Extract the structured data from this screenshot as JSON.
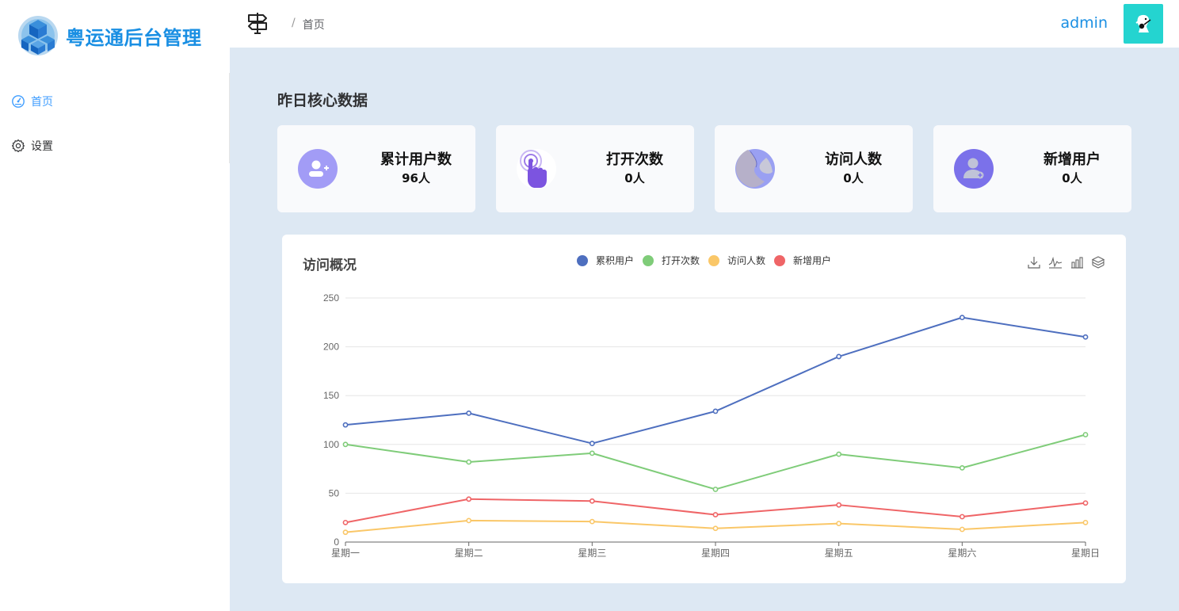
{
  "brand": {
    "title": "粤运通后台管理"
  },
  "sidebar": {
    "items": [
      {
        "label": "首页",
        "icon": "dashboard-icon",
        "active": true
      },
      {
        "label": "设置",
        "icon": "gear-icon",
        "active": false
      }
    ]
  },
  "header": {
    "breadcrumb": {
      "separator": "/",
      "current": "首页"
    },
    "username": "admin"
  },
  "main": {
    "section_title": "昨日核心数据",
    "stats": [
      {
        "label": "累计用户数",
        "value": "96人",
        "icon": "add-user-icon"
      },
      {
        "label": "打开次数",
        "value": "0人",
        "icon": "tap-hand-icon"
      },
      {
        "label": "访问人数",
        "value": "0人",
        "icon": "visitors-icon"
      },
      {
        "label": "新增用户",
        "value": "0人",
        "icon": "new-user-icon"
      }
    ],
    "chart_title": "访问概况"
  },
  "colors": {
    "accent": "#409eff",
    "brand": "#1a8fe3",
    "background": "#dde8f3",
    "avatar_bg": "#24d4d0"
  },
  "chart_data": {
    "type": "line",
    "categories": [
      "星期一",
      "星期二",
      "星期三",
      "星期四",
      "星期五",
      "星期六",
      "星期日"
    ],
    "series": [
      {
        "name": "累积用户",
        "color": "#4e6fbf",
        "values": [
          120,
          132,
          101,
          134,
          190,
          230,
          210
        ]
      },
      {
        "name": "打开次数",
        "color": "#7fcc79",
        "values": [
          100,
          82,
          91,
          54,
          90,
          76,
          110
        ]
      },
      {
        "name": "访问人数",
        "color": "#fac768",
        "values": [
          10,
          22,
          21,
          14,
          19,
          13,
          20
        ]
      },
      {
        "name": "新增用户",
        "color": "#ef6567",
        "values": [
          20,
          44,
          42,
          28,
          38,
          26,
          40
        ]
      }
    ],
    "ylim": [
      0,
      250
    ],
    "yticks": [
      "0",
      "50",
      "100",
      "150",
      "200",
      "250"
    ],
    "grid": true,
    "legend": "top-center",
    "toolbox": [
      "download-icon",
      "line-chart-icon",
      "bar-chart-icon",
      "stack-icon"
    ]
  }
}
